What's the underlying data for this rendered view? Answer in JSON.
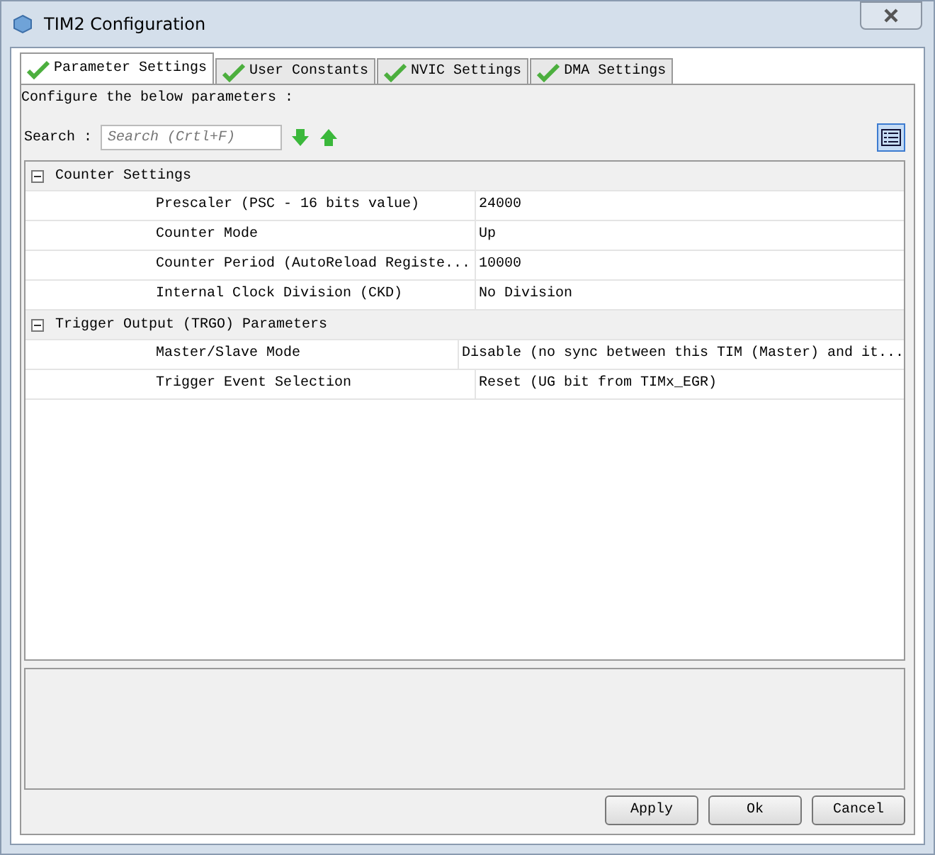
{
  "window": {
    "title": "TIM2 Configuration"
  },
  "tabs": [
    {
      "label": "Parameter Settings",
      "selected": true
    },
    {
      "label": "User Constants",
      "selected": false
    },
    {
      "label": "NVIC Settings",
      "selected": false
    },
    {
      "label": "DMA Settings",
      "selected": false
    }
  ],
  "intro": "Configure the below parameters :",
  "search": {
    "label": "Search :",
    "placeholder": "Search (Crtl+F)"
  },
  "groups": [
    {
      "name": "Counter Settings",
      "expanded": true,
      "children": [
        {
          "name": "Prescaler (PSC - 16 bits value)",
          "value": "24000"
        },
        {
          "name": "Counter Mode",
          "value": "Up"
        },
        {
          "name": "Counter Period (AutoReload Registe...",
          "value": "10000"
        },
        {
          "name": "Internal Clock Division (CKD)",
          "value": "No Division"
        }
      ]
    },
    {
      "name": "Trigger Output (TRGO) Parameters",
      "expanded": true,
      "children": [
        {
          "name": "Master/Slave Mode",
          "value": "Disable (no sync between this TIM (Master) and it..."
        },
        {
          "name": "Trigger Event Selection",
          "value": "Reset (UG bit from TIMx_EGR)"
        }
      ]
    }
  ],
  "buttons": [
    "Apply",
    "Ok",
    "Cancel"
  ]
}
